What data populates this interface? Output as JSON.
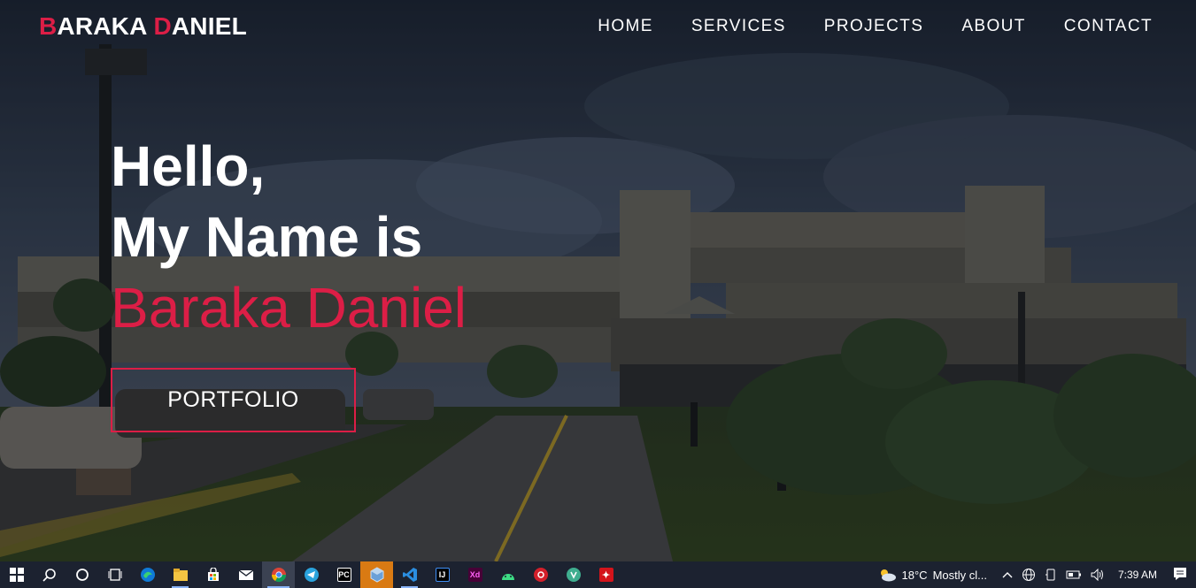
{
  "brand": {
    "first": "B",
    "first_rest": "ARAKA ",
    "last": "D",
    "last_rest": "ANIEL",
    "accent": "#dc1e46"
  },
  "nav": [
    {
      "label": "HOME"
    },
    {
      "label": "SERVICES"
    },
    {
      "label": "PROJECTS"
    },
    {
      "label": "ABOUT"
    },
    {
      "label": "CONTACT"
    }
  ],
  "hero": {
    "line1": "Hello,",
    "line2": "My Name is",
    "name": "Baraka Daniel",
    "cta": "PORTFOLIO"
  },
  "taskbar": {
    "apps": [
      {
        "icon": "windows-start-icon"
      },
      {
        "icon": "search-icon"
      },
      {
        "icon": "cortana-icon"
      },
      {
        "icon": "task-view-icon"
      },
      {
        "icon": "edge-icon"
      },
      {
        "icon": "file-explorer-icon"
      },
      {
        "icon": "store-icon"
      },
      {
        "icon": "mail-icon"
      },
      {
        "icon": "chrome-icon"
      },
      {
        "icon": "telegram-icon"
      },
      {
        "icon": "pycharm-icon"
      },
      {
        "icon": "virtualbox-icon"
      },
      {
        "icon": "vscode-icon"
      },
      {
        "icon": "intellij-icon"
      },
      {
        "icon": "adobe-xd-icon"
      },
      {
        "icon": "android-studio-icon"
      },
      {
        "icon": "davinci-icon"
      },
      {
        "icon": "vpn-icon"
      },
      {
        "icon": "acrobat-icon"
      }
    ],
    "weather_temp": "18°C",
    "weather_text": "Mostly cl...",
    "time": "7:39 AM"
  }
}
